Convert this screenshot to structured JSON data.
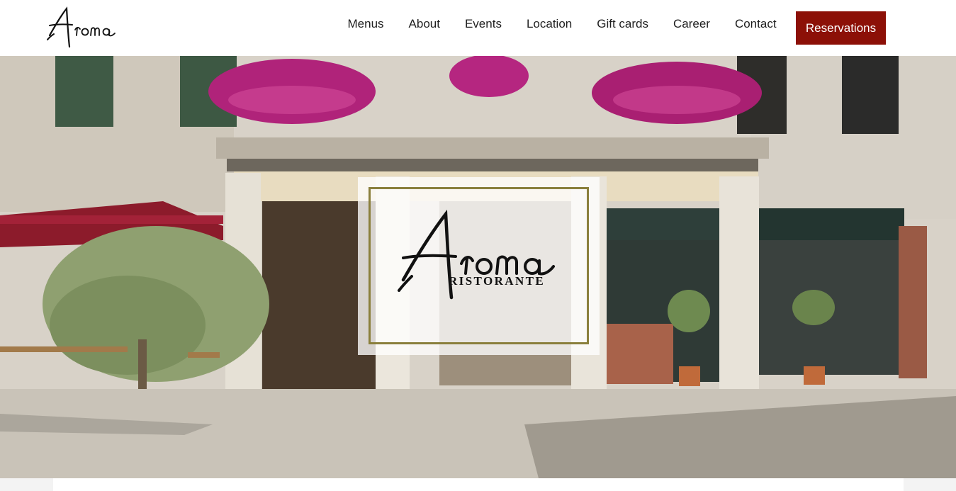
{
  "brand": {
    "logo_text": "Aroma"
  },
  "nav": {
    "items": [
      {
        "label": "Menus"
      },
      {
        "label": "About"
      },
      {
        "label": "Events"
      },
      {
        "label": "Location"
      },
      {
        "label": "Gift cards"
      },
      {
        "label": "Career"
      },
      {
        "label": "Contact"
      }
    ],
    "reservations_label": "Reservations"
  },
  "hero": {
    "logo_text": "Aroma",
    "subtitle": "RISTORANTE",
    "image": "restaurant-storefront-photo"
  },
  "colors": {
    "accent": "#8c1007",
    "frame": "#8a7f3c",
    "nav_text": "#1f1f1f"
  }
}
